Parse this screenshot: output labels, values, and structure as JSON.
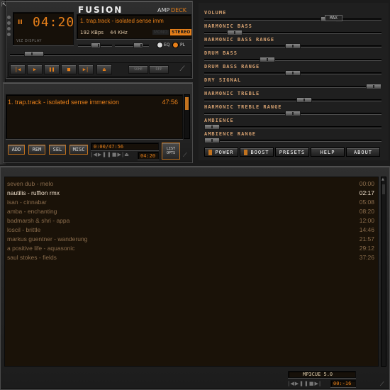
{
  "player": {
    "brand": "FUSION",
    "amp_label_1": "AMP",
    "amp_label_2": "DECK",
    "play_indicator": "II",
    "time": "04:20",
    "track_title": "1. trap.track - isolated sense imm",
    "bitrate": "192 KBps",
    "samplerate": "44 KHz",
    "mono_label": "MONO",
    "stereo_label": "STEREO",
    "viz_label": "VIZ DISPLAY",
    "eq_label": "EQ",
    "pl_label": "PL",
    "mode_btn_1": "SOHE",
    "mode_btn_2": "REP"
  },
  "miniplaylist": {
    "entry": "1. trap.track - isolated sense immersion",
    "duration": "47:56",
    "buttons": [
      "ADD",
      "REM",
      "SEL",
      "MISC"
    ],
    "position": "0:00/47:56",
    "elapsed": "04:20",
    "list_opts": "LIST OPTS"
  },
  "equalizer": {
    "sliders": [
      {
        "label": "VOLUME",
        "value": 0.72
      },
      {
        "label": "HARMONIC BASS",
        "value": 0.14
      },
      {
        "label": "HARMONIC BASS RANGE",
        "value": 0.5
      },
      {
        "label": "DRUM BASS",
        "value": 0.34
      },
      {
        "label": "DRUM BASS RANGE",
        "value": 0.5
      },
      {
        "label": "DRY SIGNAL",
        "value": 1.0
      },
      {
        "label": "HARMONIC TREBLE",
        "value": 0.57
      },
      {
        "label": "HARMONIC TREBLE RANGE",
        "value": 0.5
      },
      {
        "label": "AMBIENCE",
        "value": 0.0
      },
      {
        "label": "AMBIENCE RANGE",
        "value": 0.0
      }
    ],
    "max_label": "MAX",
    "buttons": [
      "POWER",
      "BOOST",
      "PRESETS",
      "HELP",
      "ABOUT"
    ]
  },
  "playlist": {
    "items": [
      {
        "title": "seven dub - melo",
        "duration": "00:00",
        "state": "dim"
      },
      {
        "title": "nautilis - ruffion rmx",
        "duration": "02:17",
        "state": "hi"
      },
      {
        "title": "isan - cinnabar",
        "duration": "05:08",
        "state": "dim"
      },
      {
        "title": "amba - enchanting",
        "duration": "08:20",
        "state": "dim"
      },
      {
        "title": "badmarsh & shri - appa",
        "duration": "12:00",
        "state": "dim"
      },
      {
        "title": "loscil - brittle",
        "duration": "14:46",
        "state": "dim"
      },
      {
        "title": "markus guentner - wanderung",
        "duration": "21:57",
        "state": "dim"
      },
      {
        "title": "a positive life - aquasonic",
        "duration": "29:12",
        "state": "dim"
      },
      {
        "title": "saul stokes - fields",
        "duration": "37:26",
        "state": "dim"
      }
    ],
    "footer_title": "MP3CUE 5.0",
    "footer_time": "00:-16"
  },
  "colors": {
    "accent": "#e8801a",
    "lcd_bg": "#161009",
    "text_dim": "#8a6c4c"
  }
}
